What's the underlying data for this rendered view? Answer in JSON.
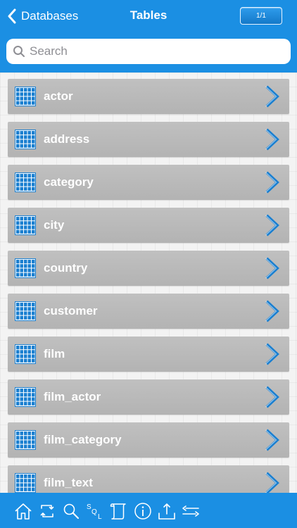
{
  "header": {
    "back_label": "Databases",
    "title": "Tables",
    "page_indicator": "1/1"
  },
  "search": {
    "placeholder": "Search",
    "value": ""
  },
  "tables": [
    {
      "name": "actor"
    },
    {
      "name": "address"
    },
    {
      "name": "category"
    },
    {
      "name": "city"
    },
    {
      "name": "country"
    },
    {
      "name": "customer"
    },
    {
      "name": "film"
    },
    {
      "name": "film_actor"
    },
    {
      "name": "film_category"
    },
    {
      "name": "film_text"
    }
  ],
  "toolbar": {
    "icons": [
      "home-icon",
      "refresh-icon",
      "search-icon",
      "sql-icon",
      "scroll-icon",
      "info-icon",
      "upload-icon",
      "sort-icon"
    ]
  },
  "colors": {
    "accent": "#1b8fe3",
    "row": "#b8b8b8",
    "icon_blue": "#1a7fd0"
  }
}
